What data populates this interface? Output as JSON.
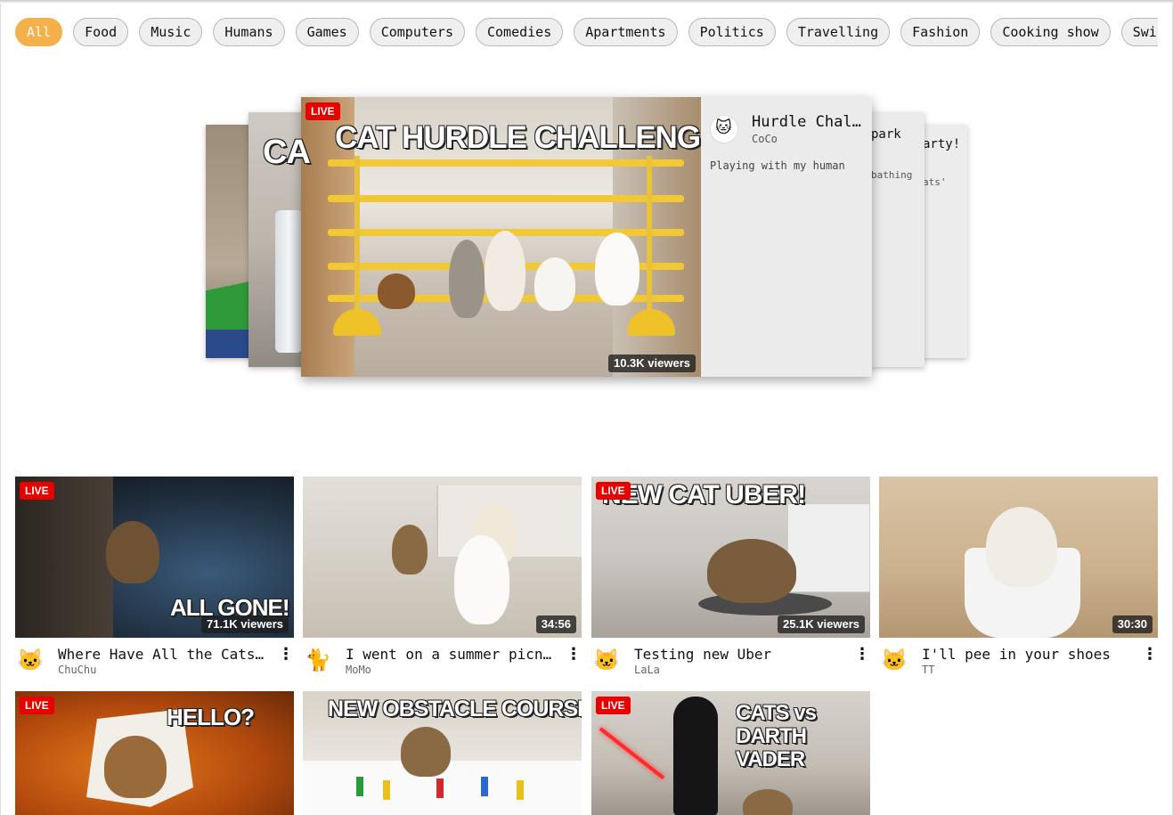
{
  "chips": [
    "All",
    "Food",
    "Music",
    "Humans",
    "Games",
    "Computers",
    "Comedies",
    "Apartments",
    "Politics",
    "Travelling",
    "Fashion",
    "Cooking show",
    "Swi"
  ],
  "active_chip": "All",
  "colors": {
    "accent": "#f4b04a",
    "live": "#e80000",
    "chip_bg": "#efefef"
  },
  "carousel": {
    "featured": {
      "live_label": "LIVE",
      "thumb_caption": "CAT HURDLE CHALLENGE!",
      "title": "Hurdle Chal…",
      "channel": "CoCo",
      "description": "Playing with my human",
      "viewers": "10.3K viewers",
      "avatar_icon": "cat-face-icon"
    },
    "back_left_caption": "CA",
    "back_right_1": {
      "title": "park",
      "sub": "bathing"
    },
    "back_right_2": {
      "title": "arty!",
      "sub": "ats'"
    }
  },
  "videos": [
    {
      "title": "Where Have All the Cats…",
      "channel": "ChuChu",
      "live": "LIVE",
      "badge": "71.1K viewers",
      "caption": "ALL GONE!",
      "avatar": "🐱"
    },
    {
      "title": "I went on a summer picn…",
      "channel": "MoMo",
      "live": "",
      "badge": "34:56",
      "caption": "",
      "avatar": "🐈"
    },
    {
      "title": "Testing new Uber",
      "channel": "LaLa",
      "live": "LIVE",
      "badge": "25.1K viewers",
      "caption": "NEW CAT UBER!",
      "avatar": "🐱"
    },
    {
      "title": "I'll pee in your shoes",
      "channel": "TT",
      "live": "",
      "badge": "30:30",
      "caption": "",
      "avatar": "🐱"
    },
    {
      "title": "",
      "channel": "",
      "live": "LIVE",
      "badge": "",
      "caption": "HELLO?",
      "avatar": ""
    },
    {
      "title": "",
      "channel": "",
      "live": "",
      "badge": "",
      "caption": "NEW OBSTACLE COURSE",
      "avatar": ""
    },
    {
      "title": "",
      "channel": "",
      "live": "LIVE",
      "badge": "",
      "caption": "CATS vs DARTH VADER",
      "avatar": ""
    }
  ],
  "more_icon": "⋮"
}
